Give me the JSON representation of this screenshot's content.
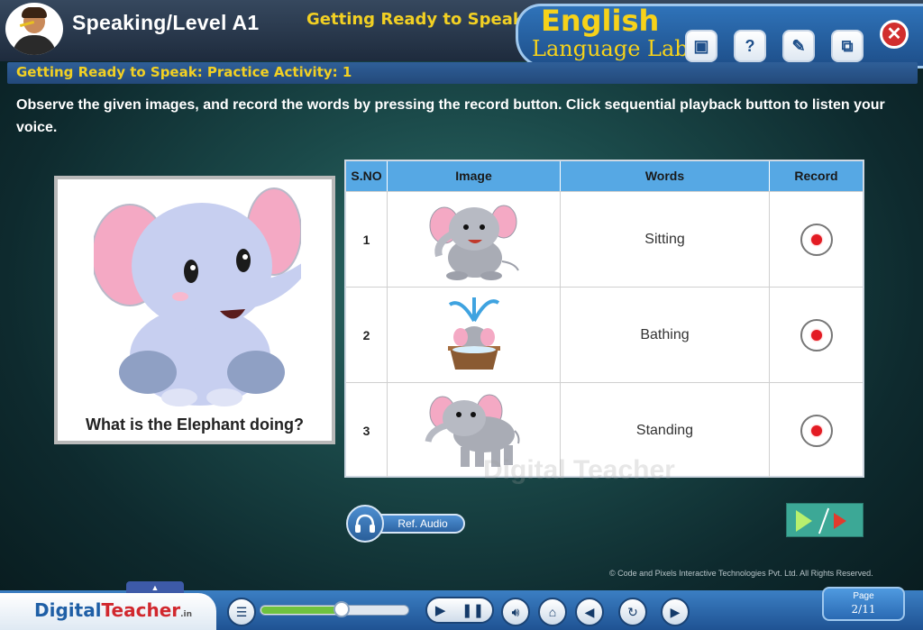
{
  "header": {
    "title": "Speaking/Level A1",
    "subtitle": "Getting Ready to Speak",
    "brand_line1": "English",
    "brand_line2": "Language Lab",
    "tools": [
      {
        "name": "notes-icon",
        "glyph": "▣"
      },
      {
        "name": "help-icon",
        "glyph": "?"
      },
      {
        "name": "glossary-icon",
        "glyph": "✎"
      },
      {
        "name": "exit-window-icon",
        "glyph": "⧉"
      }
    ],
    "close_glyph": "✕"
  },
  "activity": {
    "title": "Getting Ready to Speak: Practice Activity: 1",
    "instructions": "Observe the given images, and record the words by pressing the record button. Click sequential playback button to listen your voice."
  },
  "picture_card": {
    "question": "What is the Elephant doing?"
  },
  "table": {
    "headers": [
      "S.NO",
      "Image",
      "Words",
      "Record"
    ],
    "rows": [
      {
        "sno": "1",
        "image": "sitting-elephant",
        "word": "Sitting"
      },
      {
        "sno": "2",
        "image": "bathing-elephant",
        "word": "Bathing"
      },
      {
        "sno": "3",
        "image": "standing-elephant",
        "word": "Standing"
      }
    ]
  },
  "watermark": "Digital Teacher",
  "ref_audio": {
    "label": "Ref. Audio",
    "icon": "headphones-icon"
  },
  "copyright": "© Code and Pixels Interactive Technologies  Pvt. Ltd. All Rights Reserved.",
  "footer": {
    "logo_digital": "Digital",
    "logo_teacher": "Teacher",
    "logo_suffix": ".in",
    "tab_glyph": "▲",
    "progress_fraction": 0.55,
    "page_label": "Page",
    "page_number": "2/11"
  },
  "colors": {
    "accent_yellow": "#f2d023",
    "brand_blue": "#2f73b9",
    "table_header": "#56a8e4",
    "record_red": "#e31b23",
    "progress_green": "#6fc23f"
  }
}
